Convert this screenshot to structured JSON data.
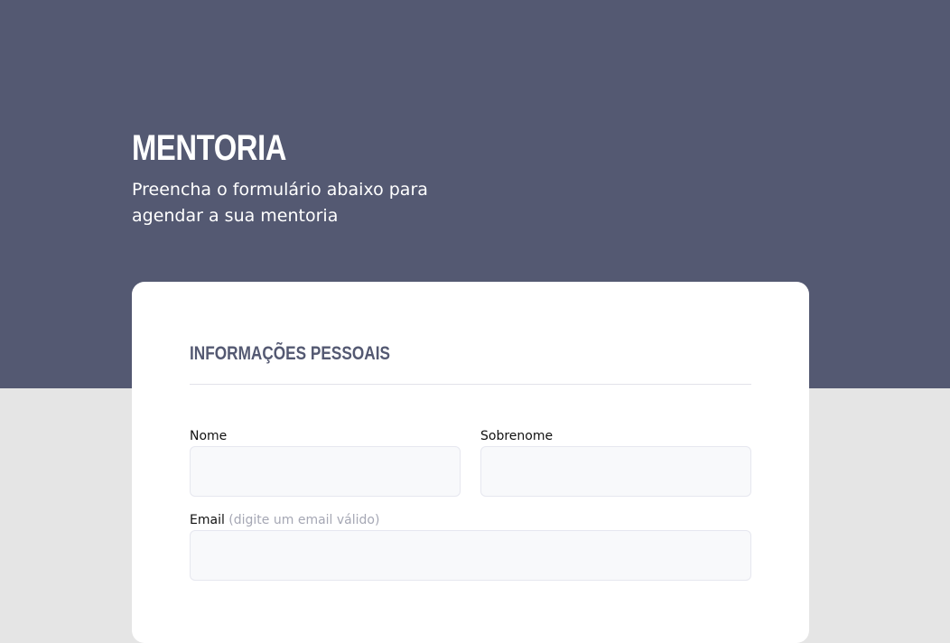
{
  "hero": {
    "title": "MENTORIA",
    "subtitle": "Preencha o formulário abaixo para agendar a sua mentoria"
  },
  "form": {
    "section_title": "INFORMAÇÕES PESSOAIS",
    "fields": {
      "nome": {
        "label": "Nome",
        "value": ""
      },
      "sobrenome": {
        "label": "Sobrenome",
        "value": ""
      },
      "email": {
        "label": "Email",
        "hint": "(digite um email válido)",
        "value": ""
      }
    }
  },
  "colors": {
    "hero_bg": "#545972",
    "page_bg": "#e5e5e5",
    "card_bg": "#ffffff",
    "input_bg": "#f8f9fb",
    "hint": "#a5a7b4"
  }
}
